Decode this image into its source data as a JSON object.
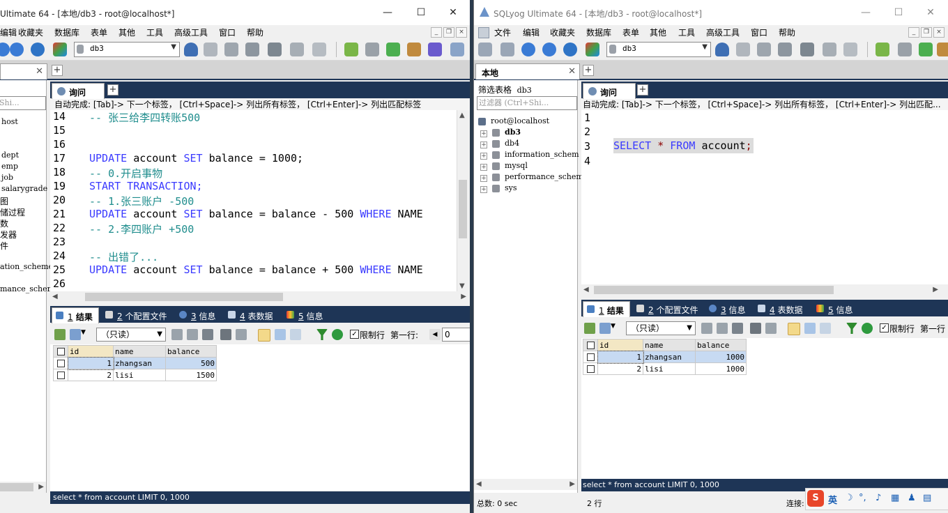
{
  "left_window": {
    "title": "Ultimate 64 - [本地/db3 - root@localhost*]",
    "menu": [
      "编辑",
      "收藏夹",
      "数据库",
      "表单",
      "其他",
      "工具",
      "高级工具",
      "窗口",
      "帮助"
    ],
    "db_selector": "db3",
    "sidebar_filter_placeholder": "Shi...",
    "sidebar_items": [
      "host",
      "dept",
      "emp",
      "job",
      "salarygrade",
      "图",
      "储过程",
      "数",
      "发器",
      "件",
      "ation_scheme",
      "mance_scheme"
    ],
    "query_tab": "询问",
    "hint": "自动完成: [Tab]-> 下一个标签， [Ctrl+Space]-> 列出所有标签， [Ctrl+Enter]-> 列出匹配标签",
    "code_lines": [
      {
        "n": "14",
        "t": "-- 张三给李四转账500",
        "k": "cm"
      },
      {
        "n": "15",
        "t": "",
        "k": "tx"
      },
      {
        "n": "16",
        "t": "",
        "k": "tx"
      },
      {
        "n": "17",
        "t": "UPDATE account SET balance = 1000;",
        "k": "mix1"
      },
      {
        "n": "18",
        "t": "-- 0.开启事物",
        "k": "cm"
      },
      {
        "n": "19",
        "t": "START TRANSACTION;",
        "k": "kw"
      },
      {
        "n": "20",
        "t": "-- 1.张三账户 -500",
        "k": "cm"
      },
      {
        "n": "21",
        "t": "UPDATE account SET balance = balance - 500 WHERE NAME",
        "k": "mix2"
      },
      {
        "n": "22",
        "t": "-- 2.李四账户 +500",
        "k": "cm"
      },
      {
        "n": "23",
        "t": "",
        "k": "tx"
      },
      {
        "n": "24",
        "t": "-- 出错了...",
        "k": "cm"
      },
      {
        "n": "25",
        "t": "UPDATE account SET balance = balance + 500 WHERE NAME",
        "k": "mix2"
      },
      {
        "n": "26",
        "t": "",
        "k": "tx"
      }
    ],
    "result_tabs": [
      {
        "num": "1",
        "label": " 结果"
      },
      {
        "num": "2",
        "label": " 个配置文件"
      },
      {
        "num": "3",
        "label": " 信息"
      },
      {
        "num": "4",
        "label": " 表数据"
      },
      {
        "num": "5",
        "label": " 信息"
      }
    ],
    "readonly_label": "（只读）",
    "limit_label": "限制行",
    "first_row_label": "第一行:",
    "first_row_value": "0",
    "columns": [
      "id",
      "name",
      "balance"
    ],
    "rows": [
      [
        "1",
        "zhangsan",
        "500"
      ],
      [
        "2",
        "lisi",
        "1500"
      ]
    ],
    "status_query": "select * from account LIMIT 0, 1000"
  },
  "right_window": {
    "title": "SQLyog Ultimate 64 - [本地/db3 - root@localhost*]",
    "menu": [
      "文件",
      "编辑",
      "收藏夹",
      "数据库",
      "表单",
      "其他",
      "工具",
      "高级工具",
      "窗口",
      "帮助"
    ],
    "db_selector": "db3",
    "conn_tab": "本地",
    "filter_label": "筛选表格",
    "filter_db": "db3",
    "filter_placeholder": "过滤器 (Ctrl+Shi...",
    "tree_root": "root@localhost",
    "tree_dbs": [
      "db3",
      "db4",
      "information_schem",
      "mysql",
      "performance_schem",
      "sys"
    ],
    "query_tab": "询问",
    "hint": "自动完成: [Tab]-> 下一个标签， [Ctrl+Space]-> 列出所有标签， [Ctrl+Enter]-> 列出匹配...",
    "line_numbers": [
      "1",
      "2",
      "3",
      "4"
    ],
    "code_kw1": "SELECT",
    "code_star": "*",
    "code_kw2": "FROM",
    "code_tbl": "account",
    "code_semi": ";",
    "result_tabs": [
      {
        "num": "1",
        "label": " 结果"
      },
      {
        "num": "2",
        "label": " 个配置文件"
      },
      {
        "num": "3",
        "label": " 信息"
      },
      {
        "num": "4",
        "label": " 表数据"
      },
      {
        "num": "5",
        "label": " 信息"
      }
    ],
    "readonly_label": "（只读）",
    "limit_label": "限制行",
    "first_row_label": "第一行",
    "columns": [
      "id",
      "name",
      "balance"
    ],
    "rows": [
      [
        "1",
        "zhangsan",
        "1000"
      ],
      [
        "2",
        "lisi",
        "1000"
      ]
    ],
    "status_query": "select * from account LIMIT 0, 1000",
    "status_time": "总数: 0 sec",
    "status_rows": "2 行",
    "status_conn": "连接:",
    "ime_lang": "英"
  }
}
